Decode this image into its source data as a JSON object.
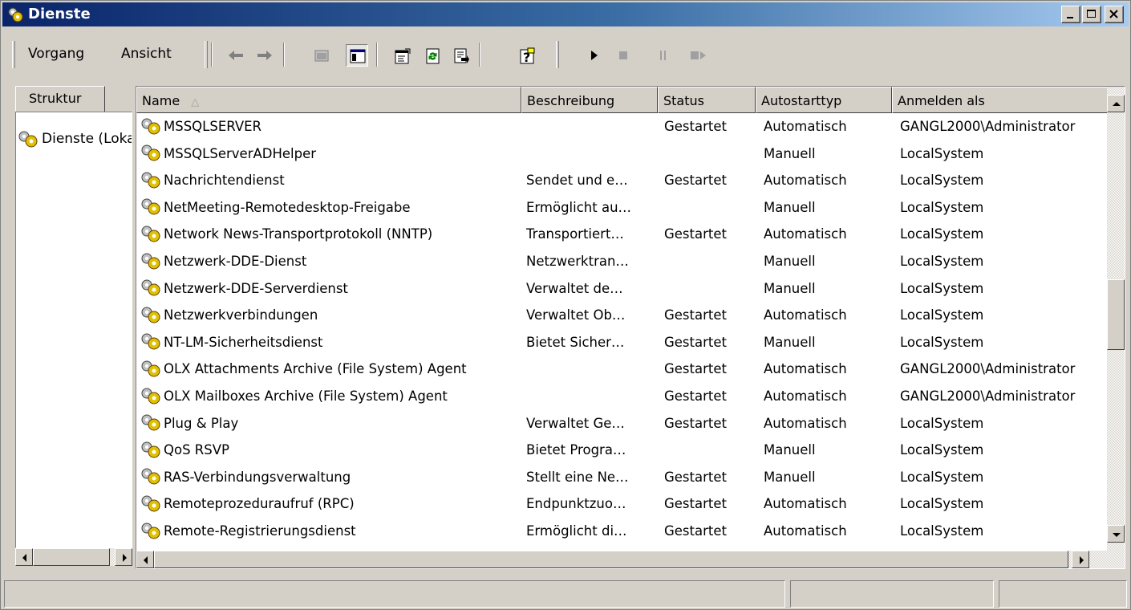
{
  "window": {
    "title": "Dienste",
    "controls": [
      "minimize-icon",
      "maximize-icon",
      "close-icon"
    ]
  },
  "menu": {
    "items": [
      {
        "label": "Vorgang",
        "accel": "o"
      },
      {
        "label": "Ansicht",
        "accel": "A"
      }
    ]
  },
  "toolbar": {
    "buttons": [
      "back-arrow-icon",
      "forward-arrow-icon",
      "up-folder-icon",
      "show-hide-tree-icon",
      "properties-icon",
      "refresh-icon",
      "export-list-icon",
      "help-icon",
      "start-service-icon",
      "stop-service-icon",
      "pause-service-icon",
      "restart-service-icon"
    ]
  },
  "left_pane": {
    "tab_label": "Struktur",
    "tree_item": "Dienste (Lokal)"
  },
  "list": {
    "columns": [
      "Name",
      "Beschreibung",
      "Status",
      "Autostarttyp",
      "Anmelden als"
    ],
    "sort_column": "Name",
    "rows": [
      [
        "MSSQLSERVER",
        "",
        "Gestartet",
        "Automatisch",
        "GANGL2000\\Administrator"
      ],
      [
        "MSSQLServerADHelper",
        "",
        "",
        "Manuell",
        "LocalSystem"
      ],
      [
        "Nachrichtendienst",
        "Sendet und e…",
        "Gestartet",
        "Automatisch",
        "LocalSystem"
      ],
      [
        "NetMeeting-Remotedesktop-Freigabe",
        "Ermöglicht au…",
        "",
        "Manuell",
        "LocalSystem"
      ],
      [
        "Network News-Transportprotokoll (NNTP)",
        "Transportiert…",
        "Gestartet",
        "Automatisch",
        "LocalSystem"
      ],
      [
        "Netzwerk-DDE-Dienst",
        "Netzwerktran…",
        "",
        "Manuell",
        "LocalSystem"
      ],
      [
        "Netzwerk-DDE-Serverdienst",
        "Verwaltet de…",
        "",
        "Manuell",
        "LocalSystem"
      ],
      [
        "Netzwerkverbindungen",
        "Verwaltet Ob…",
        "Gestartet",
        "Automatisch",
        "LocalSystem"
      ],
      [
        "NT-LM-Sicherheitsdienst",
        "Bietet Sicher…",
        "Gestartet",
        "Manuell",
        "LocalSystem"
      ],
      [
        "OLX Attachments Archive (File System) Agent",
        "",
        "Gestartet",
        "Automatisch",
        "GANGL2000\\Administrator"
      ],
      [
        "OLX Mailboxes Archive (File System) Agent",
        "",
        "Gestartet",
        "Automatisch",
        "GANGL2000\\Administrator"
      ],
      [
        "Plug & Play",
        "Verwaltet Ge…",
        "Gestartet",
        "Automatisch",
        "LocalSystem"
      ],
      [
        "QoS RSVP",
        "Bietet Progra…",
        "",
        "Manuell",
        "LocalSystem"
      ],
      [
        "RAS-Verbindungsverwaltung",
        "Stellt eine Ne…",
        "Gestartet",
        "Manuell",
        "LocalSystem"
      ],
      [
        "Remoteprozeduraufruf (RPC)",
        "Endpunktzuo…",
        "Gestartet",
        "Automatisch",
        "LocalSystem"
      ],
      [
        "Remote-Registrierungsdienst",
        "Ermöglicht di…",
        "Gestartet",
        "Automatisch",
        "LocalSystem"
      ]
    ]
  },
  "statusbar": {
    "panels": [
      "",
      "",
      ""
    ]
  },
  "colors": {
    "titlebar_start": "#0a246a",
    "titlebar_end": "#a6caf0",
    "face": "#d4d0c8"
  }
}
